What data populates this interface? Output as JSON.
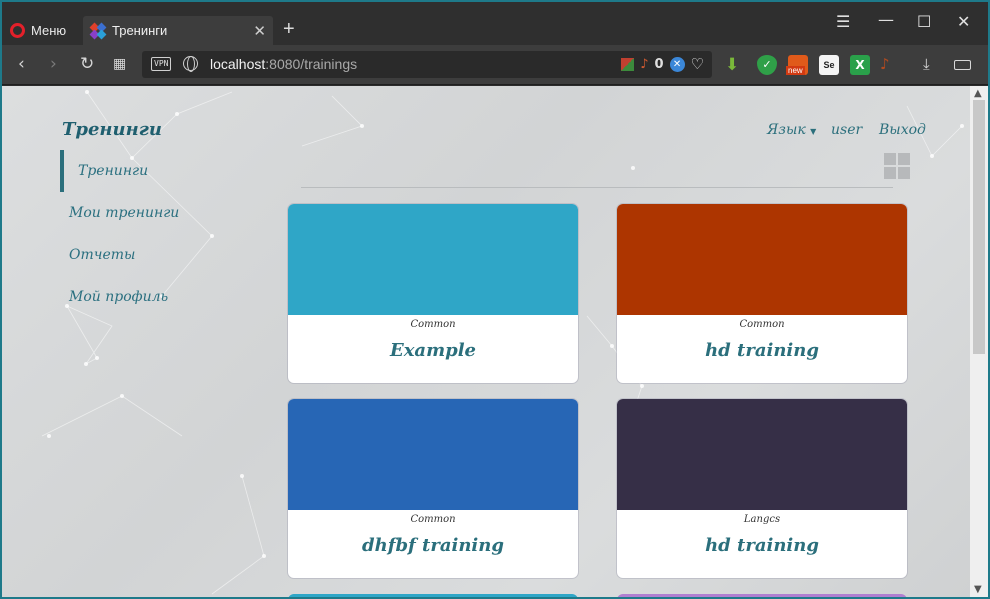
{
  "browser": {
    "menu_label": "Меню",
    "tab_title": "Тренинги",
    "url_host": "localhost",
    "url_rest": ":8080/trainings",
    "vpn_label": "VPN",
    "adblock_count": "0",
    "ext_new_badge": "new"
  },
  "app": {
    "brand": "Тренинги",
    "sidebar": [
      {
        "label": "Тренинги",
        "active": true
      },
      {
        "label": "Мои тренинги",
        "active": false
      },
      {
        "label": "Отчеты",
        "active": false
      },
      {
        "label": "Мой профиль",
        "active": false
      }
    ],
    "topnav": {
      "language": "Язык",
      "user": "user",
      "logout": "Выход"
    },
    "cards": [
      {
        "category": "Common",
        "title": "Example",
        "color": "#2fa6c7"
      },
      {
        "category": "Common",
        "title": "hd training",
        "color": "#ad3500"
      },
      {
        "category": "Common",
        "title": "dhfbf training",
        "color": "#2766b5"
      },
      {
        "category": "Langcs",
        "title": "hd training",
        "color": "#362f47"
      }
    ],
    "peek_colors": [
      "#2fa6c7",
      "#b07fd0"
    ]
  }
}
